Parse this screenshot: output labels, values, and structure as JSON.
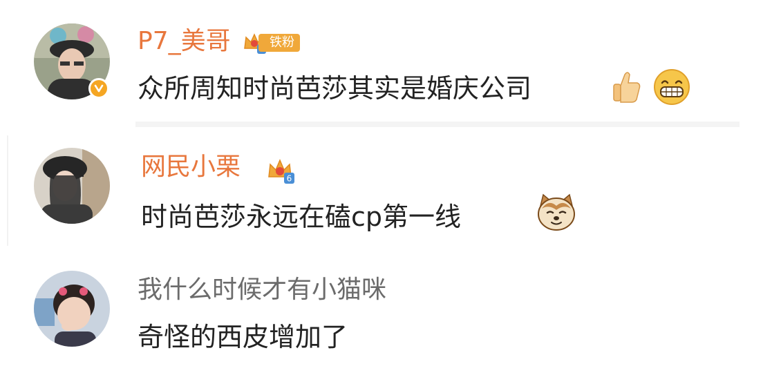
{
  "comments": [
    {
      "username": "P7_美哥",
      "badge": {
        "level": "6",
        "label": "铁粉"
      },
      "verified": true,
      "text": "众所周知时尚芭莎其实是婚庆公司",
      "emojis": [
        "thumbs-up-icon",
        "grin-icon"
      ]
    },
    {
      "username": "网民小栗",
      "badge": {
        "level": "6",
        "label": ""
      },
      "verified": false,
      "text": "时尚芭莎永远在磕cp第一线",
      "emojis": [
        "cat-face-icon"
      ]
    },
    {
      "username": "我什么时候才有小猫咪",
      "badge": null,
      "verified": false,
      "text": "奇怪的西皮增加了",
      "emojis": []
    }
  ],
  "colors": {
    "fan_name": "#e8773d",
    "plain_name": "#6b6b6b",
    "text": "#222222",
    "badge": "#f0a83a",
    "verified": "#f5a623"
  }
}
